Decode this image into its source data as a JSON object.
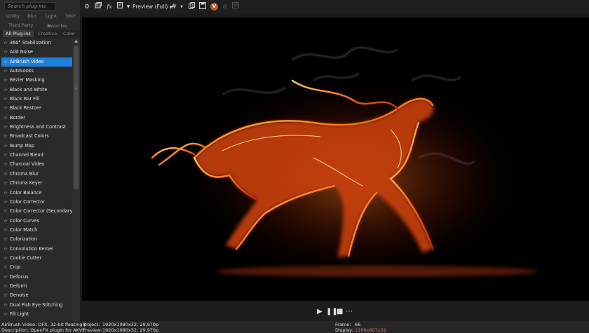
{
  "left_panel": {
    "search_placeholder": "Search plug-ins",
    "category_rows": [
      [
        "Utility",
        "Blur",
        "Light",
        "360°"
      ],
      [
        "Third Party",
        "Favorites"
      ],
      [
        "All Plug-ins",
        "Creative",
        "Color"
      ]
    ],
    "plugins": [
      {
        "label": "360° Stabilization",
        "selected": false
      },
      {
        "label": "Add Noise",
        "selected": false
      },
      {
        "label": "AirBrush Video",
        "selected": true
      },
      {
        "label": "AutoLooks",
        "selected": false
      },
      {
        "label": "Bézier Masking",
        "selected": false
      },
      {
        "label": "Black and White",
        "selected": false
      },
      {
        "label": "Black Bar Fill",
        "selected": false
      },
      {
        "label": "Black Restore",
        "selected": false
      },
      {
        "label": "Border",
        "selected": false
      },
      {
        "label": "Brightness and Contrast",
        "selected": false
      },
      {
        "label": "Broadcast Colors",
        "selected": false
      },
      {
        "label": "Bump Map",
        "selected": false
      },
      {
        "label": "Channel Blend",
        "selected": false
      },
      {
        "label": "Charcoal Video",
        "selected": false
      },
      {
        "label": "Chroma Blur",
        "selected": false
      },
      {
        "label": "Chroma Keyer",
        "selected": false
      },
      {
        "label": "Color Balance",
        "selected": false
      },
      {
        "label": "Color Corrector",
        "selected": false
      },
      {
        "label": "Color Corrector (Secondary)",
        "selected": false
      },
      {
        "label": "Color Curves",
        "selected": false
      },
      {
        "label": "Color Match",
        "selected": false
      },
      {
        "label": "Colorization",
        "selected": false
      },
      {
        "label": "Convolution Kernel",
        "selected": false
      },
      {
        "label": "Cookie Cutter",
        "selected": false
      },
      {
        "label": "Crop",
        "selected": false
      },
      {
        "label": "Defocus",
        "selected": false
      },
      {
        "label": "Deform",
        "selected": false
      },
      {
        "label": "Denoise",
        "selected": false
      },
      {
        "label": "Dual Fish Eye Stitching",
        "selected": false
      },
      {
        "label": "Fill Light",
        "selected": false
      }
    ]
  },
  "toolbar": {
    "preview_mode": "Preview (Full)",
    "icons": [
      "gear-icon",
      "window-icon",
      "fx-icon",
      "flag-icon",
      "triangle-down-icon",
      "grid-icon",
      "caret-down-icon",
      "copy-icon",
      "save-icon",
      "v-badge-icon",
      "disabled-icon",
      "overlay-icon"
    ],
    "v_badge": "V",
    "accent_badge_color": "#c0581c"
  },
  "transport": {
    "icons": [
      "play-icon",
      "pause-icon",
      "stop-icon",
      "more-icon"
    ]
  },
  "status": {
    "plugin_info_line1": "AirBrush Video: OFX, 32-bit floating p",
    "plugin_info_line2": "Description: OpenFX plugin for AKVI",
    "project_label": "Project:",
    "project_value": "1920x1080x32; 29,970p",
    "preview_label": "Preview:",
    "preview_value": "1920x1080x32; 29,970p",
    "frame_label": "Frame:",
    "frame_value": "66",
    "display_label": "Display:",
    "display_value": "1186x667x32"
  },
  "colors": {
    "selection": "#1e7fd8",
    "panel": "#2a2a2a",
    "display_value": "#e07a6a"
  }
}
